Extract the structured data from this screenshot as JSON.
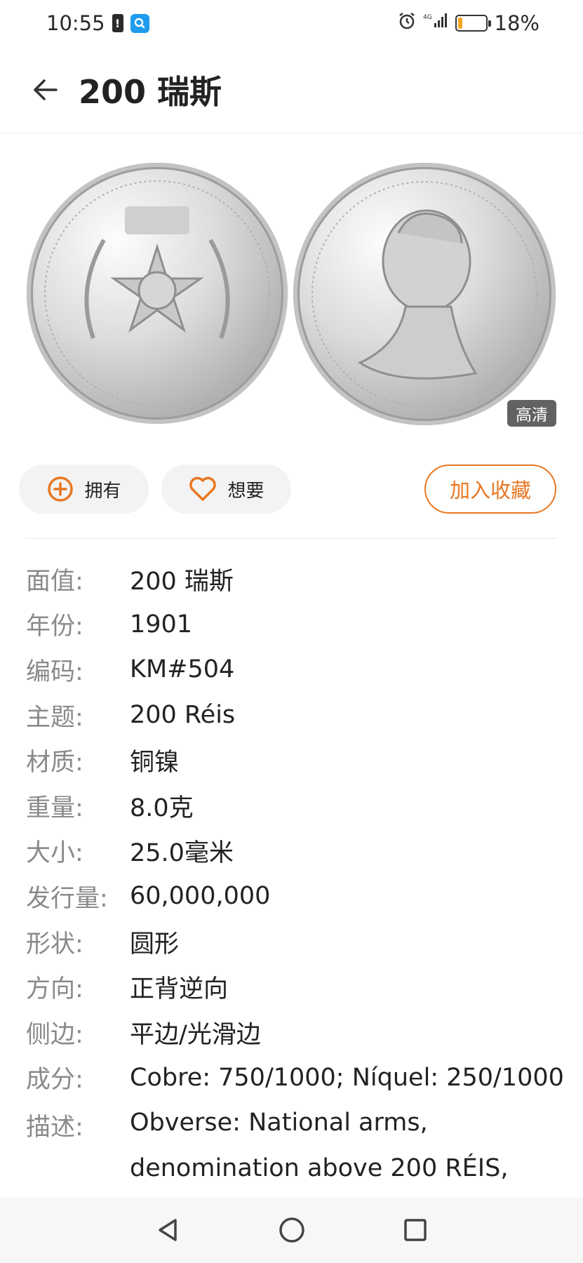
{
  "status_bar": {
    "time": "10:55",
    "battery_percent": "18%",
    "battery_level": 0.18,
    "network": "4G"
  },
  "header": {
    "title": "200 瑞斯"
  },
  "images": {
    "hd_badge": "高清"
  },
  "actions": {
    "own_label": "拥有",
    "want_label": "想要",
    "collect_label": "加入收藏"
  },
  "details": [
    {
      "label": "面值:",
      "value": "200 瑞斯"
    },
    {
      "label": "年份:",
      "value": "1901"
    },
    {
      "label": "编码:",
      "value": "KM#504"
    },
    {
      "label": "主题:",
      "value": "200 Réis"
    },
    {
      "label": "材质:",
      "value": "铜镍"
    },
    {
      "label": "重量:",
      "value": "8.0克"
    },
    {
      "label": "大小:",
      "value": "25.0毫米"
    },
    {
      "label": "发行量:",
      "value": "60,000,000"
    },
    {
      "label": "形状:",
      "value": "圆形"
    },
    {
      "label": "方向:",
      "value": "正背逆向"
    },
    {
      "label": "侧边:",
      "value": "平边/光滑边"
    },
    {
      "label": "成分:",
      "value": "Cobre: 750/1000; Níquel: 250/1000"
    }
  ],
  "description": {
    "label": "描述:",
    "value": "Obverse: National arms, denomination above 200 RÉIS,"
  },
  "icons": {
    "back": "arrow-left-icon",
    "own": "plus-circle-icon",
    "want": "heart-icon",
    "nav_back": "triangle-back-icon",
    "nav_home": "circle-home-icon",
    "nav_recent": "square-recent-icon"
  },
  "colors": {
    "accent": "#e87722",
    "label": "#8a8a8a",
    "text": "#222222"
  }
}
